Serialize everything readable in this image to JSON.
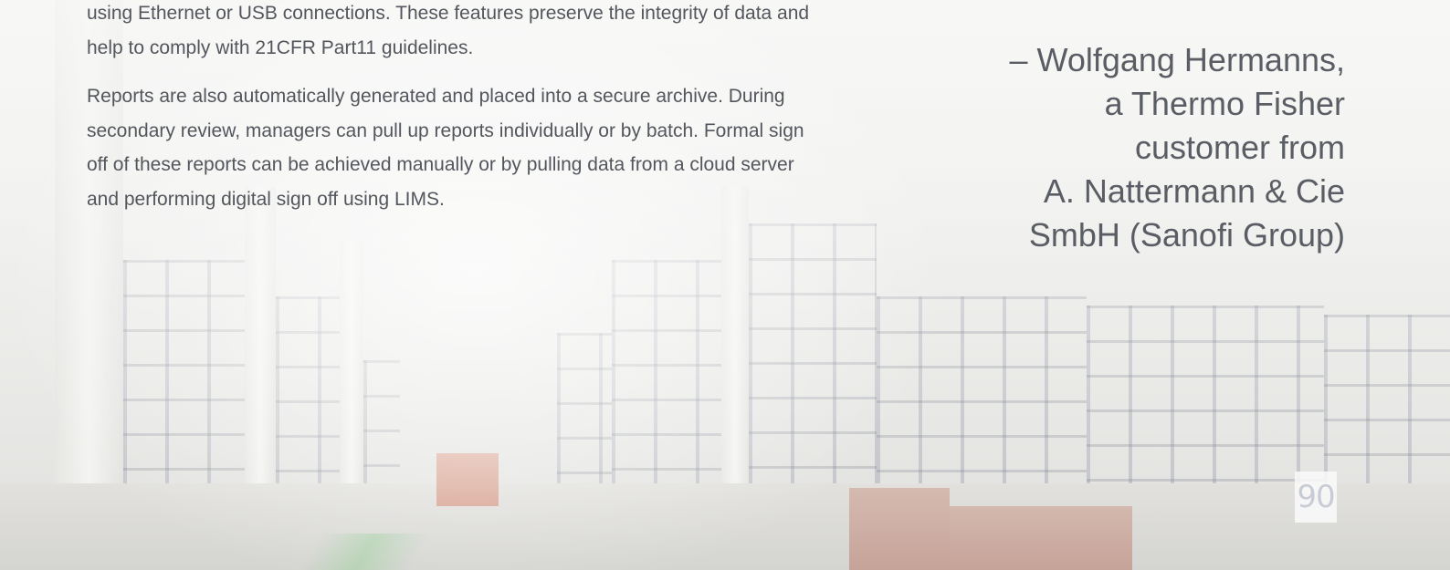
{
  "body": {
    "paragraphs": [
      {
        "lines": [
          "using Ethernet or USB connections. These features preserve the integrity of data and",
          "help to comply with 21CFR Part11 guidelines."
        ]
      },
      {
        "lines": [
          "Reports are also automatically generated and placed into a secure archive. During",
          "secondary review, managers can pull up reports individually or by batch. Formal sign",
          "off of these reports can be achieved manually or by pulling data from a cloud server",
          "and performing digital sign off using LIMS."
        ]
      }
    ]
  },
  "attribution": {
    "lines": [
      "– Wolfgang Hermanns,",
      "a Thermo Fisher",
      "customer from",
      "A. Nattermann & Cie",
      "SmbH (Sanofi Group)"
    ]
  },
  "background": {
    "sign_text": "90"
  }
}
